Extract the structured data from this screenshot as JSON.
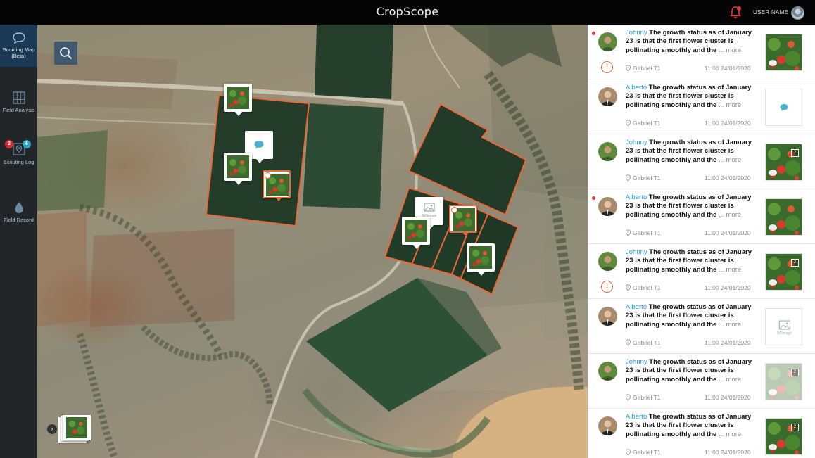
{
  "app": {
    "title": "CropScope"
  },
  "header": {
    "user_name": "USER NAME",
    "notification_icon": "bell-icon",
    "has_unread_notifications": true
  },
  "nav": {
    "items": [
      {
        "id": "scouting-map",
        "label": "Scouting Map (Beta)",
        "icon": "chat-bubble-icon",
        "active": true
      },
      {
        "id": "field-analysis",
        "label": "Field Analysis",
        "icon": "grid-icon",
        "active": false
      },
      {
        "id": "scouting-log",
        "label": "Scouting Log",
        "icon": "map-pin-icon",
        "active": false,
        "badges": [
          "2",
          "6"
        ]
      },
      {
        "id": "field-record",
        "label": "Field Record",
        "icon": "water-drop-icon",
        "active": false
      }
    ]
  },
  "map": {
    "search_icon": "search-icon",
    "noimage_label": "NOimage",
    "expand_icon": "chevron-right-icon",
    "expand_glyph": "›"
  },
  "feed": {
    "more_label": "more",
    "items": [
      {
        "author": "Johnny",
        "text": "The growth status as of January 23 is that the first flower cluster is pollinating smoothly and the ...",
        "location": "Gabriel T1",
        "time": "11:00 24/01/2020",
        "unread": true,
        "alert": true,
        "thumb": "photo-chat"
      },
      {
        "author": "Alberto",
        "text": "The growth status as of January 23 is that the first flower cluster is pollinating smoothly and the ...",
        "location": "Gabriel T1",
        "time": "11:00 24/01/2020",
        "unread": false,
        "alert": false,
        "thumb": "comment"
      },
      {
        "author": "Johnny",
        "text": "The growth status as of January 23 is that the first flower cluster is pollinating smoothly and the ...",
        "location": "Gabriel T1",
        "time": "11:00 24/01/2020",
        "unread": false,
        "alert": false,
        "thumb": "photo-multi"
      },
      {
        "author": "Alberto",
        "text": "The growth status as of January 23 is that the first flower cluster is pollinating smoothly and the ...",
        "location": "Gabriel T1",
        "time": "11:00 24/01/2020",
        "unread": true,
        "alert": false,
        "thumb": "photo-chat"
      },
      {
        "author": "Johnny",
        "text": "The growth status as of January 23 is that the first flower cluster is pollinating smoothly and the ...",
        "location": "Gabriel T1",
        "time": "11:00 24/01/2020",
        "unread": false,
        "alert": true,
        "thumb": "photo-multi"
      },
      {
        "author": "Alberto",
        "text": "The growth status as of January 23 is that the first flower cluster is pollinating smoothly and the ...",
        "location": "Gabriel T1",
        "time": "11:00 24/01/2020",
        "unread": false,
        "alert": false,
        "thumb": "noimage"
      },
      {
        "author": "Johnny",
        "text": "The growth status as of January 23 is that the first flower cluster is pollinating smoothly and the ...",
        "location": "Gabriel T1",
        "time": "11:00 24/01/2020",
        "unread": false,
        "alert": false,
        "thumb": "photo-faded"
      },
      {
        "author": "Alberto",
        "text": "The growth status as of January 23 is that the first flower cluster is pollinating smoothly and the ...",
        "location": "Gabriel T1",
        "time": "11:00 24/01/2020",
        "unread": false,
        "alert": false,
        "thumb": "photo-multi"
      }
    ]
  },
  "colors": {
    "accent_blue": "#2a9fd0",
    "alert_orange": "#e8683a",
    "nav_bg": "#232628",
    "nav_active": "#1b3a56"
  }
}
